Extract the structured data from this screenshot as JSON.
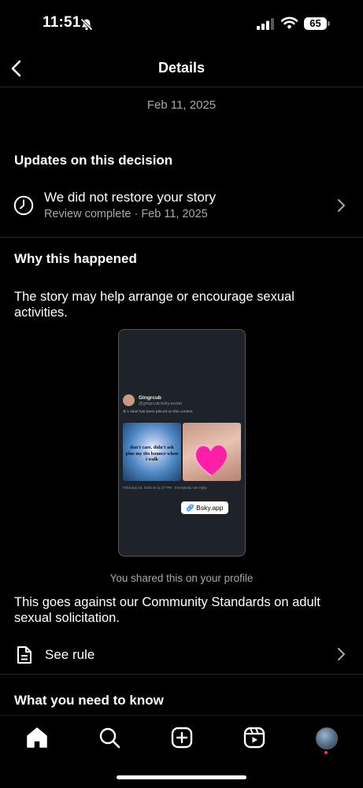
{
  "status_bar": {
    "time": "11:51",
    "battery": "65"
  },
  "header": {
    "title": "Details"
  },
  "date_label": "Feb 11, 2025",
  "updates": {
    "title": "Updates on this decision",
    "item_title": "We did not restore your story",
    "item_status": "Review complete",
    "item_date": "Feb 11, 2025"
  },
  "why": {
    "title": "Why this happened",
    "text": "The story may help arrange or encourage sexual activities."
  },
  "preview": {
    "username": "Gingrcub",
    "handle": "@gingrcub.bsky.social",
    "label_notice": "1 label has been placed on this content",
    "image_caption": "don't care, didn't ask plus my tits bounce when i walk",
    "footer": "February 10, 2025 at 11:27 PM · Everybody can reply",
    "link_chip": "Bsky.app"
  },
  "shared_note": "You shared this on your profile",
  "standards_text": "This goes against our Community Standards on adult sexual solicitation.",
  "see_rule": "See rule",
  "need_to_know": {
    "title": "What you need to know"
  },
  "colors": {
    "background": "#000000",
    "muted": "#a8a8a8",
    "divider": "#262626",
    "notification_dot": "#ff3040"
  }
}
